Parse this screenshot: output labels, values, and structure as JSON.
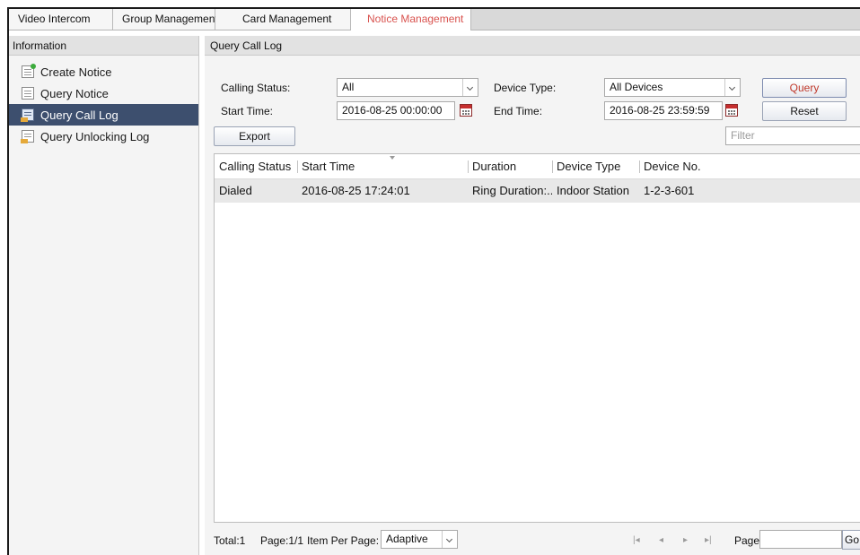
{
  "tabs": [
    {
      "label": "Video Intercom",
      "active": false
    },
    {
      "label": "Group Management",
      "active": false
    },
    {
      "label": "Card Management",
      "active": false
    },
    {
      "label": "Notice Management",
      "active": true
    }
  ],
  "sidebar": {
    "title": "Information",
    "items": [
      {
        "label": "Create Notice",
        "icon": "create-notice-icon",
        "active": false
      },
      {
        "label": "Query Notice",
        "icon": "query-notice-icon",
        "active": false
      },
      {
        "label": "Query Call Log",
        "icon": "call-log-icon",
        "active": true
      },
      {
        "label": "Query Unlocking Log",
        "icon": "unlocking-log-icon",
        "active": false
      }
    ]
  },
  "main": {
    "title": "Query Call Log",
    "form": {
      "calling_status_label": "Calling Status:",
      "calling_status_value": "All",
      "device_type_label": "Device Type:",
      "device_type_value": "All Devices",
      "start_time_label": "Start Time:",
      "start_time_value": "2016-08-25 00:00:00",
      "end_time_label": "End Time:",
      "end_time_value": "2016-08-25 23:59:59",
      "query_label": "Query",
      "reset_label": "Reset",
      "export_label": "Export",
      "filter_placeholder": "Filter"
    },
    "table": {
      "columns": [
        "Calling Status",
        "Start Time",
        "Duration",
        "Device Type",
        "Device No."
      ],
      "rows": [
        [
          "Dialed",
          "2016-08-25 17:24:01",
          "Ring Duration:...",
          "Indoor Station",
          "1-2-3-601"
        ]
      ]
    },
    "footer": {
      "total": "Total:1",
      "page_info": "Page:1/1",
      "items_per_page_label": "Item Per Page:",
      "items_per_page_value": "Adaptive",
      "page_label": "Page",
      "go_label": "Go"
    }
  },
  "colors": {
    "active_tab_text": "#d9534f",
    "active_nav_bg": "#3d4f6e",
    "query_text": "#c0392b"
  }
}
